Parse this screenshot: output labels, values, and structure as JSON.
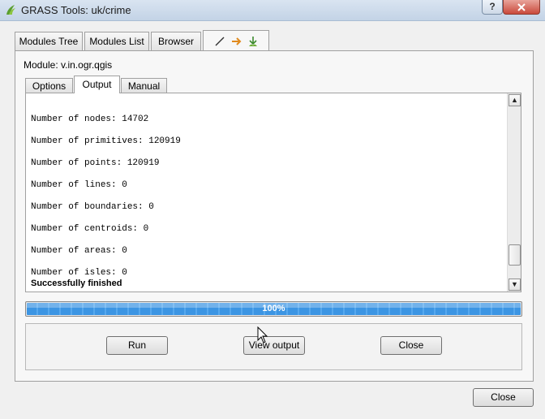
{
  "window": {
    "title": "GRASS Tools: uk/crime",
    "help_label": "?",
    "close_label": "x"
  },
  "outer_tabs": [
    {
      "label": "Modules Tree"
    },
    {
      "label": "Modules List"
    },
    {
      "label": "Browser"
    }
  ],
  "module": {
    "label": "Module: v.in.ogr.qgis"
  },
  "inner_tabs": [
    {
      "label": "Options"
    },
    {
      "label": "Output",
      "active": true
    },
    {
      "label": "Manual"
    }
  ],
  "output": {
    "lines": [
      "Number of nodes: 14702",
      "Number of primitives: 120919",
      "Number of points: 120919",
      "Number of lines: 0",
      "Number of boundaries: 0",
      "Number of centroids: 0",
      "Number of areas: 0",
      "Number of isles: 0"
    ],
    "status": "Successfully finished"
  },
  "progress": {
    "value": 100,
    "label": "100%"
  },
  "buttons": {
    "run": "Run",
    "view_output": "View output",
    "close_inner": "Close",
    "close_dialog": "Close"
  },
  "icons": {
    "app": "grass-leaf-icon",
    "tab_edit": "pencil-icon",
    "tab_arrow": "arrow-right-icon",
    "tab_grass": "grass-import-icon"
  },
  "colors": {
    "progress_fill": "#3c95e3",
    "window_close": "#c9493b"
  }
}
